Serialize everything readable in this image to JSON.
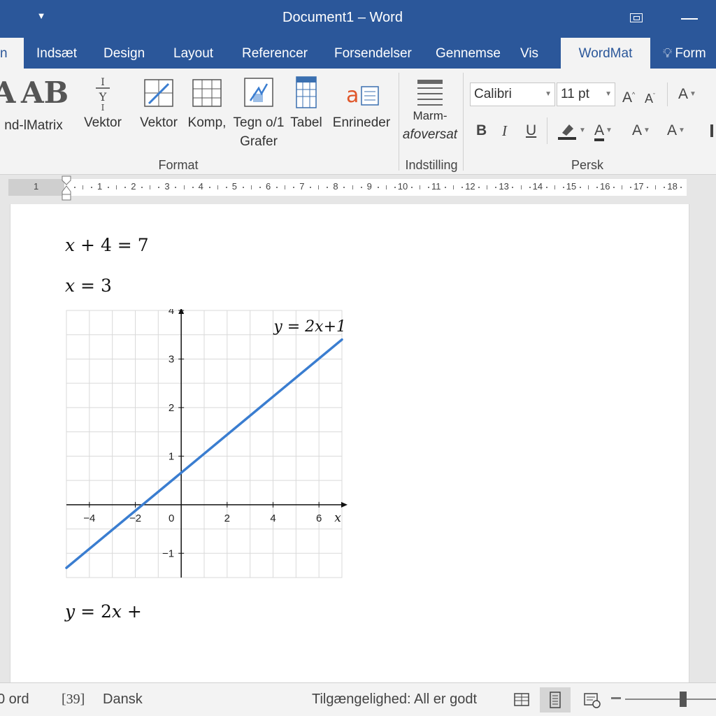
{
  "window": {
    "title": "Document1  –  Word",
    "qat_caret": "▼"
  },
  "tabs": [
    {
      "label": "n"
    },
    {
      "label": "Indsæt"
    },
    {
      "label": "Design"
    },
    {
      "label": "Layout"
    },
    {
      "label": "Referencer"
    },
    {
      "label": "Forsendelser"
    },
    {
      "label": "Gennemse"
    },
    {
      "label": "Vis"
    },
    {
      "label": "WordMat"
    },
    {
      "label": "Form"
    }
  ],
  "ribbon": {
    "format_group": {
      "label": "Format",
      "buttons": [
        "nd-lMatrix",
        "Vektor",
        "Vektor",
        "Komp,",
        "Tegn o/1",
        "Grafer",
        "Tabel",
        "Enrineder"
      ],
      "glyph_A": "A",
      "glyph_AB": "AB",
      "glyph_a": "a"
    },
    "settings_group": {
      "label": "Indstilling",
      "button_line1": "Marm-",
      "button_line2": "afoversat"
    },
    "font_group": {
      "label": "Persk",
      "font_name": "Calibri",
      "font_size": "11 pt",
      "grow": "A",
      "shrink": "A",
      "clear": "A",
      "bold": "B",
      "italic": "I",
      "underline": "U",
      "font_color": "A",
      "text_effect": "A",
      "case": "A"
    }
  },
  "ruler": {
    "left_label": "1",
    "numbers": [
      "1",
      "2",
      "3",
      "4",
      "5",
      "6",
      "7",
      "8",
      "9",
      "10",
      "11",
      "12",
      "13",
      "14",
      "15",
      "16",
      "17",
      "18"
    ]
  },
  "document": {
    "eq1": {
      "var": "x",
      "rest": " + 4 = 7"
    },
    "eq2": {
      "var": "x",
      "rest": " = 3"
    },
    "eq3": {
      "y": "y",
      "mid": " = 2",
      "x": "x",
      "end": " +"
    }
  },
  "chart_data": {
    "type": "line",
    "xlim": [
      -5,
      7
    ],
    "ylim": [
      -1.5,
      4
    ],
    "x_ticks": [
      -4,
      -2,
      0,
      2,
      4,
      6
    ],
    "x_tick_labels": [
      "−4",
      "−2",
      "0",
      "2",
      "4",
      "6"
    ],
    "y_ticks": [
      4,
      3,
      2,
      1,
      -1
    ],
    "y_tick_labels": [
      "4",
      "3",
      "2",
      "1",
      "−1"
    ],
    "xlabel": "x",
    "ylabel": "",
    "grid": true,
    "line_color": "#3a7dd0",
    "annotation": "y = 2x+1",
    "series": [
      {
        "name": "",
        "x": [
          -5,
          7
        ],
        "y": [
          -1.3,
          3.4
        ]
      }
    ]
  },
  "statusbar": {
    "words": "0 ord",
    "proofing": "[39]",
    "language": "Dansk",
    "accessibility": "Tilgængelighed: All er godt",
    "zoom_percent": 80
  },
  "colors": {
    "brand": "#2b579a",
    "ribbon_bg": "#f3f3f3",
    "accent_red": "#e0572a"
  }
}
